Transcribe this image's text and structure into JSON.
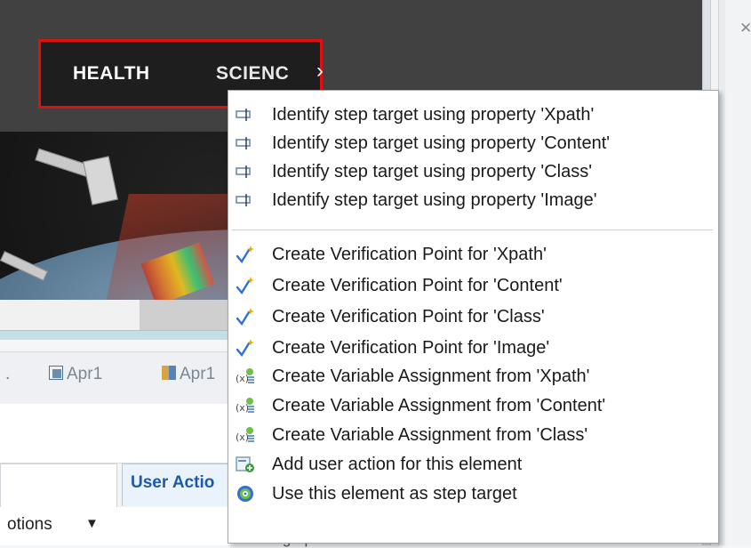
{
  "website": {
    "nav_items": [
      "HEALTH",
      "SCIENC"
    ],
    "nav_more_icon": "chevron-right-icon"
  },
  "panels": {
    "tab_fragment": ".",
    "tabs": [
      "Apr1",
      "Apr1"
    ],
    "active_tab_label": "User Actio",
    "options_label": "otions",
    "options_caret_icon": "caret-down-icon",
    "paragraph_fragment": "Paragraph",
    "right_close_icon": "close-icon"
  },
  "context_menu": {
    "groups": [
      {
        "icon": "identify-target-icon",
        "items": [
          "Identify step target using property 'Xpath'",
          "Identify step target using property 'Content'",
          "Identify step target using property 'Class'",
          "Identify step target using property 'Image'"
        ]
      },
      {
        "icon": "verification-point-icon",
        "items": [
          "Create Verification Point for 'Xpath'",
          "Create Verification Point for 'Content'",
          "Create Verification Point for 'Class'",
          "Create Verification Point for 'Image'"
        ]
      },
      {
        "icon": "variable-assignment-icon",
        "items": [
          "Create Variable Assignment from 'Xpath'",
          "Create Variable Assignment from 'Content'",
          "Create Variable Assignment from 'Class'"
        ]
      }
    ],
    "extra_items": [
      {
        "label": "Add user action for this element",
        "icon": "add-user-action-icon"
      },
      {
        "label": "Use this element as step target",
        "icon": "step-target-icon"
      }
    ]
  },
  "colors": {
    "nav_highlight_border": "#e01010",
    "active_tab_text": "#1e5aa8",
    "verification_check": "#2f6fd6",
    "verification_spark": "#e0b000"
  }
}
